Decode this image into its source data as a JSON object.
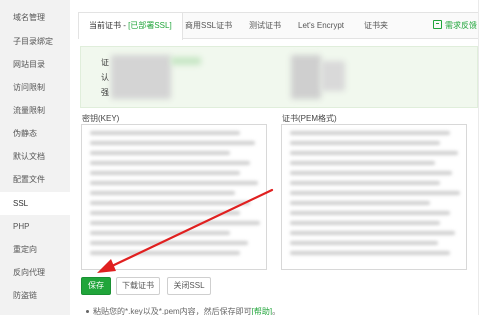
{
  "sidebar": {
    "items": [
      {
        "label": "域名管理"
      },
      {
        "label": "子目录绑定"
      },
      {
        "label": "网站目录"
      },
      {
        "label": "访问限制"
      },
      {
        "label": "流量限制"
      },
      {
        "label": "伪静态"
      },
      {
        "label": "默认文档"
      },
      {
        "label": "配置文件"
      },
      {
        "label": "SSL"
      },
      {
        "label": "PHP"
      },
      {
        "label": "重定向"
      },
      {
        "label": "反向代理"
      },
      {
        "label": "防盗链"
      }
    ],
    "active_label": "SSL"
  },
  "tabs": {
    "current_prefix": "当前证书 - ",
    "current_status": "[已部署SSL]",
    "commercial": "商用SSL证书",
    "test": "测试证书",
    "letsencrypt": "Let's Encrypt",
    "folder": "证书夹",
    "feedback": "需求反馈"
  },
  "cert_info": {
    "label1": "证",
    "label2": "认",
    "label3": "强"
  },
  "key_field": {
    "label": "密钥(KEY)"
  },
  "pem_field": {
    "label": "证书(PEM格式)"
  },
  "buttons": {
    "save": "保存",
    "download": "下载证书",
    "close_ssl": "关闭SSL"
  },
  "hint": {
    "text": "粘贴您的*.key以及*.pem内容，然后保存即可",
    "link": "[帮助]",
    "suffix": "。"
  },
  "colors": {
    "accent": "#20a53a",
    "sidebar_bg": "#f2f2f2",
    "arrow": "#e02020"
  }
}
